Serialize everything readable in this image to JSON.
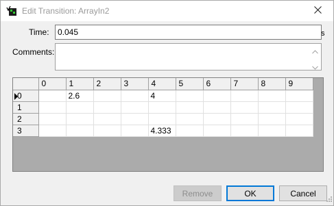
{
  "window": {
    "title": "Edit Transition: ArrayIn2"
  },
  "form": {
    "time_label": "Time:",
    "time_value": "0.045",
    "time_unit": "s",
    "comments_label": "Comments:",
    "comments_value": ""
  },
  "grid": {
    "column_headers": [
      "0",
      "1",
      "2",
      "3",
      "4",
      "5",
      "6",
      "7",
      "8",
      "9"
    ],
    "row_headers": [
      "0",
      "1",
      "2",
      "3"
    ],
    "current_row": 0,
    "rows": [
      [
        "",
        "2.6",
        "",
        "",
        "4",
        "",
        "",
        "",
        "",
        ""
      ],
      [
        "",
        "",
        "",
        "",
        "",
        "",
        "",
        "",
        "",
        ""
      ],
      [
        "",
        "",
        "",
        "",
        "",
        "",
        "",
        "",
        "",
        ""
      ],
      [
        "",
        "",
        "",
        "",
        "4.333",
        "",
        "",
        "",
        "",
        ""
      ]
    ]
  },
  "buttons": {
    "remove_label": "Remove",
    "ok_label": "OK",
    "cancel_label": "Cancel"
  },
  "icons": {
    "app": "transition-icon",
    "close": "close-icon",
    "scroll_up": "chevron-up-icon",
    "scroll_down": "chevron-down-icon",
    "current_row": "current-row-marker-icon"
  },
  "colors": {
    "accent": "#0078d7",
    "grid_background": "#ababab"
  }
}
